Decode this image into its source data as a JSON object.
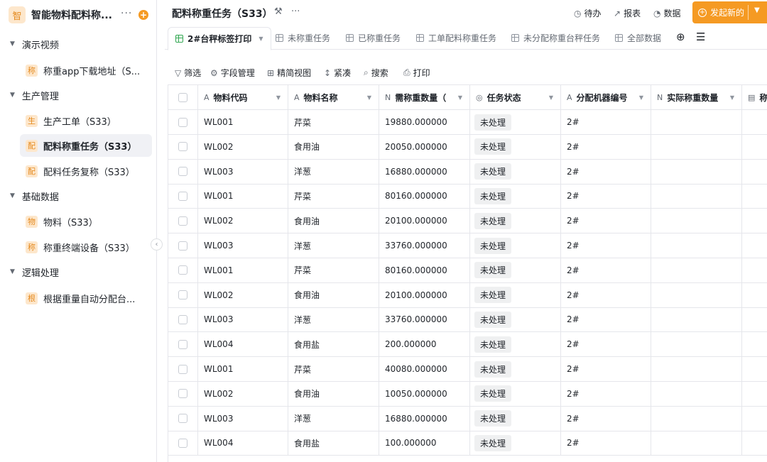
{
  "app": {
    "logo_char": "智",
    "title": "智能物料配料称...",
    "more": "···",
    "add": "+"
  },
  "sidebar": {
    "groups": [
      {
        "label": "演示视频",
        "items": [
          {
            "badge": "称",
            "label": "称重app下载地址（S..."
          }
        ]
      },
      {
        "label": "生产管理",
        "items": [
          {
            "badge": "生",
            "label": "生产工单（S33）"
          },
          {
            "badge": "配",
            "label": "配料称重任务（S33）"
          },
          {
            "badge": "配",
            "label": "配料任务复称（S33）"
          }
        ]
      },
      {
        "label": "基础数据",
        "items": [
          {
            "badge": "物",
            "label": "物料（S33）"
          },
          {
            "badge": "称",
            "label": "称重终端设备（S33）"
          }
        ]
      },
      {
        "label": "逻辑处理",
        "items": [
          {
            "badge": "根",
            "label": "根据重量自动分配台..."
          }
        ]
      }
    ]
  },
  "header": {
    "title": "配料称重任务（S33）",
    "actions": {
      "todo": "待办",
      "report": "报表",
      "data": "数据"
    },
    "primary_button": "发起新的"
  },
  "tabs": [
    {
      "label": "2#台秤标签打印",
      "active": true
    },
    {
      "label": "未称重任务"
    },
    {
      "label": "已称重任务"
    },
    {
      "label": "工单配料称重任务"
    },
    {
      "label": "未分配称重台秤任务"
    },
    {
      "label": "全部数据"
    }
  ],
  "toolbar": {
    "filter": "筛选",
    "fields": "字段管理",
    "simple_view": "精简视图",
    "compact": "紧凑",
    "search": "搜索",
    "print": "打印"
  },
  "table": {
    "columns": [
      {
        "icon": "A",
        "label": "物料代码"
      },
      {
        "icon": "A",
        "label": "物料名称"
      },
      {
        "icon": "N",
        "label": "需称重数量（"
      },
      {
        "icon": "◎",
        "label": "任务状态"
      },
      {
        "icon": "A",
        "label": "分配机器编号"
      },
      {
        "icon": "N",
        "label": "实际称重数量"
      },
      {
        "icon": "▤",
        "label": "称"
      }
    ],
    "rows": [
      [
        "WL001",
        "芹菜",
        "19880.000000",
        "未处理",
        "2#"
      ],
      [
        "WL002",
        "食用油",
        "20050.000000",
        "未处理",
        "2#"
      ],
      [
        "WL003",
        "洋葱",
        "16880.000000",
        "未处理",
        "2#"
      ],
      [
        "WL001",
        "芹菜",
        "80160.000000",
        "未处理",
        "2#"
      ],
      [
        "WL002",
        "食用油",
        "20100.000000",
        "未处理",
        "2#"
      ],
      [
        "WL003",
        "洋葱",
        "33760.000000",
        "未处理",
        "2#"
      ],
      [
        "WL001",
        "芹菜",
        "80160.000000",
        "未处理",
        "2#"
      ],
      [
        "WL002",
        "食用油",
        "20100.000000",
        "未处理",
        "2#"
      ],
      [
        "WL003",
        "洋葱",
        "33760.000000",
        "未处理",
        "2#"
      ],
      [
        "WL004",
        "食用盐",
        "200.000000",
        "未处理",
        "2#"
      ],
      [
        "WL001",
        "芹菜",
        "40080.000000",
        "未处理",
        "2#"
      ],
      [
        "WL002",
        "食用油",
        "10050.000000",
        "未处理",
        "2#"
      ],
      [
        "WL003",
        "洋葱",
        "16880.000000",
        "未处理",
        "2#"
      ],
      [
        "WL004",
        "食用盐",
        "100.000000",
        "未处理",
        "2#"
      ]
    ]
  },
  "colors": {
    "accent": "#f59a23",
    "badge_bg": "#fde7cc",
    "badge_fg": "#e58a1f",
    "active_tab_icon": "#34a853"
  }
}
